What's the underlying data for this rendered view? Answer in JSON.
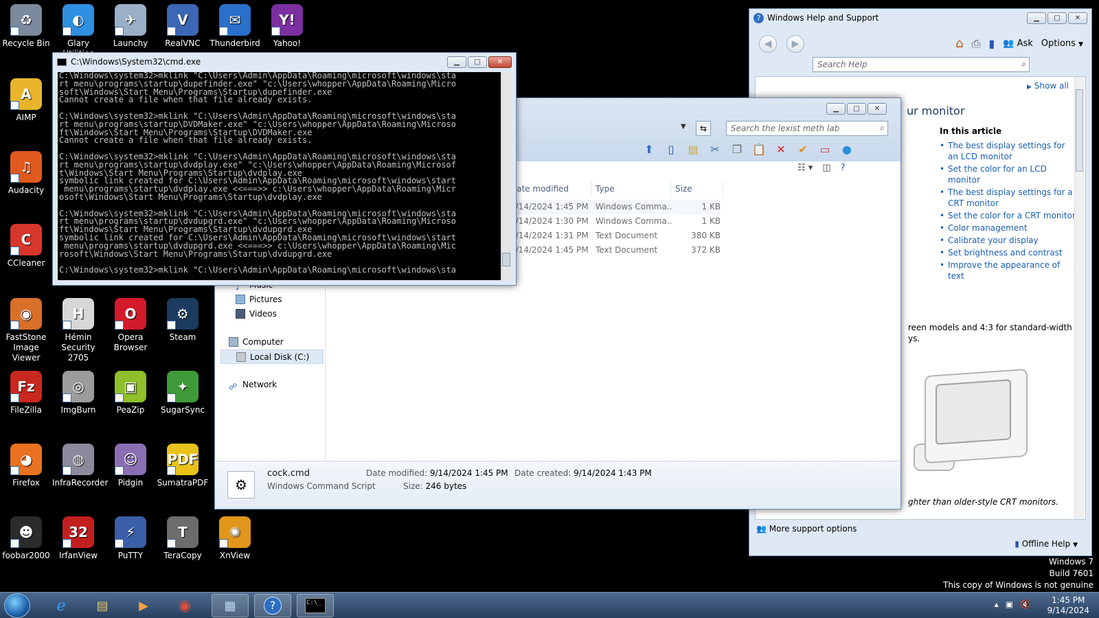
{
  "desktop": {
    "icons": [
      {
        "label": "Recycle Bin",
        "icon": "recycle-bin-icon",
        "color": "#7b8a9c",
        "glyph": "♻"
      },
      {
        "label": "Glary Utilities",
        "icon": "glary-utilities-icon",
        "color": "#2f8fe0",
        "glyph": "◐"
      },
      {
        "label": "Launchy",
        "icon": "launchy-icon",
        "color": "#9ab0c8",
        "glyph": "✈"
      },
      {
        "label": "RealVNC",
        "icon": "realvnc-icon",
        "color": "#3b67b5",
        "glyph": "V"
      },
      {
        "label": "Thunderbird",
        "icon": "thunderbird-icon",
        "color": "#2a6fc9",
        "glyph": "✉"
      },
      {
        "label": "Yahoo!",
        "icon": "yahoo-messenger-icon",
        "color": "#7b2fa0",
        "glyph": "Y!"
      },
      {
        "label": "AIMP",
        "icon": "aimp-icon",
        "color": "#e8b52a",
        "glyph": "A"
      },
      {
        "label": "Audacity",
        "icon": "audacity-icon",
        "color": "#e05a1f",
        "glyph": "♫"
      },
      {
        "label": "CCleaner",
        "icon": "ccleaner-icon",
        "color": "#d6362b",
        "glyph": "C"
      },
      {
        "label": "FastStone Image Viewer",
        "icon": "faststone-icon",
        "color": "#d9702a",
        "glyph": "◉"
      },
      {
        "label": "Hémin Security 2705",
        "icon": "hemin-security-icon",
        "color": "#d7d7d7",
        "glyph": "H"
      },
      {
        "label": "Opera Browser",
        "icon": "opera-icon",
        "color": "#d31a2a",
        "glyph": "O"
      },
      {
        "label": "Steam",
        "icon": "steam-icon",
        "color": "#1b3b5f",
        "glyph": "⚙"
      },
      {
        "label": "FileZilla",
        "icon": "filezilla-icon",
        "color": "#c8281e",
        "glyph": "Fz"
      },
      {
        "label": "ImgBurn",
        "icon": "imgburn-icon",
        "color": "#9c9c9c",
        "glyph": "◎"
      },
      {
        "label": "PeaZip",
        "icon": "peazip-icon",
        "color": "#8fbf2a",
        "glyph": "▣"
      },
      {
        "label": "SugarSync",
        "icon": "sugarsync-icon",
        "color": "#3f9a3a",
        "glyph": "✦"
      },
      {
        "label": "Firefox",
        "icon": "firefox-icon",
        "color": "#e8721f",
        "glyph": "◕"
      },
      {
        "label": "InfraRecorder",
        "icon": "infrarecorder-icon",
        "color": "#8a8a9c",
        "glyph": "◍"
      },
      {
        "label": "Pidgin",
        "icon": "pidgin-icon",
        "color": "#8b6fb3",
        "glyph": "☺"
      },
      {
        "label": "SumatraPDF",
        "icon": "sumatrapdf-icon",
        "color": "#e8c21a",
        "glyph": "PDF"
      },
      {
        "label": "foobar2000",
        "icon": "foobar2000-icon",
        "color": "#2b2b2b",
        "glyph": "☻"
      },
      {
        "label": "IrfanView",
        "icon": "irfanview-icon",
        "color": "#c21f1f",
        "glyph": "32"
      },
      {
        "label": "PuTTY",
        "icon": "putty-icon",
        "color": "#3a5ea8",
        "glyph": "⚡"
      },
      {
        "label": "TeraCopy",
        "icon": "teracopy-icon",
        "color": "#6c6c6c",
        "glyph": "T"
      },
      {
        "label": "XnView",
        "icon": "xnview-icon",
        "color": "#e0961a",
        "glyph": "✺"
      }
    ]
  },
  "cmd": {
    "title": "C:\\Windows\\System32\\cmd.exe",
    "lines": [
      "C:\\Windows\\system32>mklink \"C:\\Users\\Admin\\AppData\\Roaming\\microsoft\\windows\\sta",
      "rt menu\\programs\\startup\\dupefinder.exe\" \"c:\\Users\\whopper\\AppData\\Roaming\\Micro",
      "soft\\Windows\\Start Menu\\Programs\\Startup\\dupefinder.exe",
      "Cannot create a file when that file already exists.",
      "",
      "C:\\Windows\\system32>mklink \"C:\\Users\\Admin\\AppData\\Roaming\\microsoft\\windows\\sta",
      "rt menu\\programs\\startup\\DVDMaker.exe\" \"c:\\Users\\whopper\\AppData\\Roaming\\Microso",
      "ft\\Windows\\Start Menu\\Programs\\Startup\\DVDMaker.exe",
      "Cannot create a file when that file already exists.",
      "",
      "C:\\Windows\\system32>mklink \"C:\\Users\\Admin\\AppData\\Roaming\\microsoft\\windows\\sta",
      "rt menu\\programs\\startup\\dvdplay.exe\" \"c:\\Users\\whopper\\AppData\\Roaming\\Microsof",
      "t\\Windows\\Start Menu\\Programs\\Startup\\dvdplay.exe",
      "symbolic link created for C:\\Users\\Admin\\AppData\\Roaming\\microsoft\\windows\\start",
      " menu\\programs\\startup\\dvdplay.exe <<===>> c:\\Users\\whopper\\AppData\\Roaming\\Micr",
      "osoft\\Windows\\Start Menu\\Programs\\Startup\\dvdplay.exe",
      "",
      "C:\\Windows\\system32>mklink \"C:\\Users\\Admin\\AppData\\Roaming\\microsoft\\windows\\sta",
      "rt menu\\programs\\startup\\dvdupgrd.exe\" \"c:\\Users\\whopper\\AppData\\Roaming\\Microso",
      "ft\\Windows\\Start Menu\\Programs\\Startup\\dvdupgrd.exe",
      "symbolic link created for C:\\Users\\Admin\\AppData\\Roaming\\microsoft\\windows\\start",
      " menu\\programs\\startup\\dvdupgrd.exe <<===>> c:\\Users\\whopper\\AppData\\Roaming\\Mic",
      "rosoft\\Windows\\Start Menu\\Programs\\Startup\\dvdupgrd.exe",
      "",
      "C:\\Windows\\system32>mklink \"C:\\Users\\Admin\\AppData\\Roaming\\microsoft\\windows\\sta"
    ]
  },
  "explorer": {
    "search_placeholder": "Search the lexist meth lab",
    "nav": {
      "music": "Music",
      "pictures": "Pictures",
      "videos": "Videos",
      "computer": "Computer",
      "local_disk": "Local Disk (C:)",
      "network": "Network"
    },
    "columns": {
      "date_modified": "Date modified",
      "type": "Type",
      "size": "Size"
    },
    "rows": [
      {
        "date": "9/14/2024 1:45 PM",
        "type": "Windows Comma...",
        "size": "1 KB"
      },
      {
        "date": "9/14/2024 1:30 PM",
        "type": "Windows Comma...",
        "size": "1 KB"
      },
      {
        "date": "9/14/2024 1:31 PM",
        "type": "Text Document",
        "size": "380 KB"
      },
      {
        "date": "9/14/2024 1:45 PM",
        "type": "Text Document",
        "size": "372 KB"
      }
    ],
    "details": {
      "name": "cock.cmd",
      "kind": "Windows Command Script",
      "modified_label": "Date modified:",
      "modified": "9/14/2024 1:45 PM",
      "created_label": "Date created:",
      "created": "9/14/2024 1:43 PM",
      "size_label": "Size:",
      "size": "246 bytes"
    }
  },
  "help": {
    "title": "Windows Help and Support",
    "search_placeholder": "Search Help",
    "ask_label": "Ask",
    "options_label": "Options",
    "show_all": "Show all",
    "heading_fragment": "ur monitor",
    "in_this_article": "In this article",
    "article_links": [
      "The best display settings for an LCD monitor",
      "Set the color for an LCD monitor",
      "The best display settings for a CRT monitor",
      "Set the color for a CRT monitor",
      "Color management",
      "Calibrate your display",
      "Set brightness and contrast",
      "Improve the appearance of text"
    ],
    "body_fragment_1": "reen models and 4:3 for standard-width",
    "body_fragment_2": "ys.",
    "body_fragment_3": "ghter than older-style CRT monitors.",
    "more_support": "More support options",
    "offline_help": "Offline Help"
  },
  "watermark": {
    "line1": "Windows 7",
    "line2": "Build 7601",
    "line3": "This copy of Windows is not genuine"
  },
  "taskbar": {
    "time": "1:45 PM",
    "date": "9/14/2024"
  },
  "colors": {
    "link": "#1a5fb4",
    "desktop": "#000000",
    "taskbar": "#27405f"
  }
}
